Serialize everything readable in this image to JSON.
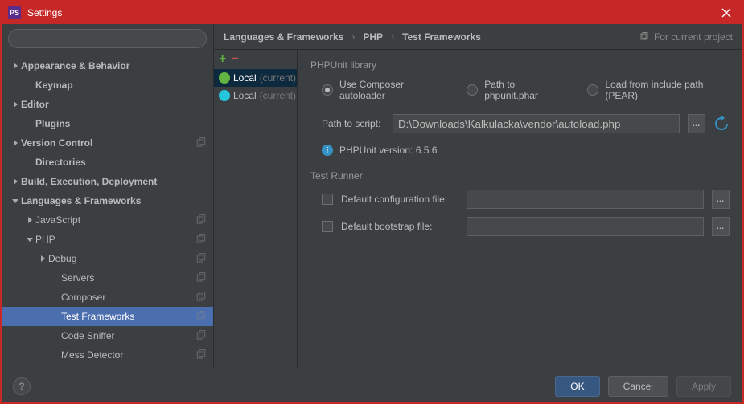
{
  "window": {
    "title": "Settings",
    "app_badge": "PS"
  },
  "search": {
    "placeholder": ""
  },
  "sidebar": {
    "items": [
      {
        "label": "Appearance & Behavior",
        "indent": 0,
        "arrow": "right",
        "bold": true
      },
      {
        "label": "Keymap",
        "indent": 1,
        "bold": true
      },
      {
        "label": "Editor",
        "indent": 0,
        "arrow": "right",
        "bold": true
      },
      {
        "label": "Plugins",
        "indent": 1,
        "bold": true
      },
      {
        "label": "Version Control",
        "indent": 0,
        "arrow": "right",
        "bold": true,
        "copy": true
      },
      {
        "label": "Directories",
        "indent": 1,
        "bold": true
      },
      {
        "label": "Build, Execution, Deployment",
        "indent": 0,
        "arrow": "right",
        "bold": true
      },
      {
        "label": "Languages & Frameworks",
        "indent": 0,
        "arrow": "down",
        "bold": true
      },
      {
        "label": "JavaScript",
        "indent": 1,
        "arrow": "right",
        "copy": true
      },
      {
        "label": "PHP",
        "indent": 1,
        "arrow": "down",
        "copy": true
      },
      {
        "label": "Debug",
        "indent": 2,
        "arrow": "right",
        "copy": true
      },
      {
        "label": "Servers",
        "indent": 3,
        "copy": true
      },
      {
        "label": "Composer",
        "indent": 3,
        "copy": true
      },
      {
        "label": "Test Frameworks",
        "indent": 3,
        "copy": true,
        "selected": true
      },
      {
        "label": "Code Sniffer",
        "indent": 3,
        "copy": true
      },
      {
        "label": "Mess Detector",
        "indent": 3,
        "copy": true
      }
    ]
  },
  "breadcrumb": {
    "parts": [
      "Languages & Frameworks",
      "PHP",
      "Test Frameworks"
    ],
    "scope": "For current project"
  },
  "configs": [
    {
      "name": "Local",
      "note": "(current)",
      "icon": "green",
      "selected": true
    },
    {
      "name": "Local",
      "note": "(current)",
      "icon": "teal"
    }
  ],
  "form": {
    "library_section": "PHPUnit library",
    "radios": {
      "composer": "Use Composer autoloader",
      "phar": "Path to phpunit.phar",
      "pear": "Load from include path (PEAR)"
    },
    "path_label": "Path to script:",
    "path_value": "D:\\Downloads\\Kalkulacka\\vendor\\autoload.php",
    "version_text": "PHPUnit version: 6.5.6",
    "runner_section": "Test Runner",
    "default_config": "Default configuration file:",
    "default_bootstrap": "Default bootstrap file:"
  },
  "footer": {
    "ok": "OK",
    "cancel": "Cancel",
    "apply": "Apply"
  }
}
